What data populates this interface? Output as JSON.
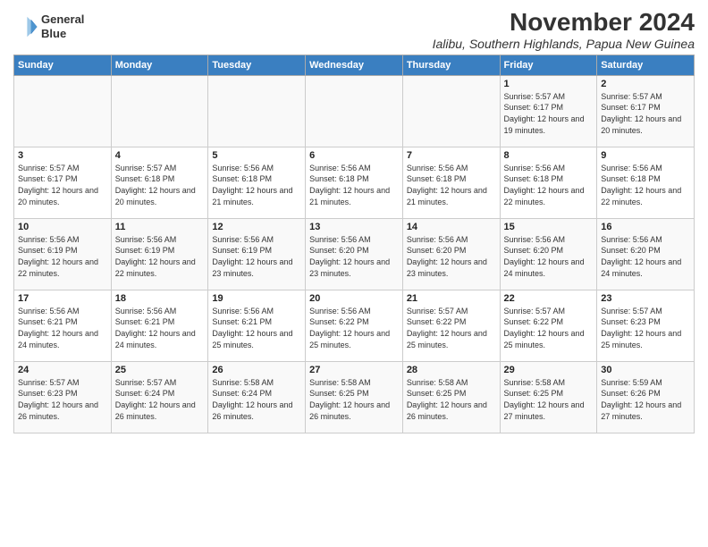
{
  "header": {
    "logo_line1": "General",
    "logo_line2": "Blue",
    "month": "November 2024",
    "location": "Ialibu, Southern Highlands, Papua New Guinea"
  },
  "weekdays": [
    "Sunday",
    "Monday",
    "Tuesday",
    "Wednesday",
    "Thursday",
    "Friday",
    "Saturday"
  ],
  "weeks": [
    [
      {
        "day": "",
        "info": ""
      },
      {
        "day": "",
        "info": ""
      },
      {
        "day": "",
        "info": ""
      },
      {
        "day": "",
        "info": ""
      },
      {
        "day": "",
        "info": ""
      },
      {
        "day": "1",
        "info": "Sunrise: 5:57 AM\nSunset: 6:17 PM\nDaylight: 12 hours and 19 minutes."
      },
      {
        "day": "2",
        "info": "Sunrise: 5:57 AM\nSunset: 6:17 PM\nDaylight: 12 hours and 20 minutes."
      }
    ],
    [
      {
        "day": "3",
        "info": "Sunrise: 5:57 AM\nSunset: 6:17 PM\nDaylight: 12 hours and 20 minutes."
      },
      {
        "day": "4",
        "info": "Sunrise: 5:57 AM\nSunset: 6:18 PM\nDaylight: 12 hours and 20 minutes."
      },
      {
        "day": "5",
        "info": "Sunrise: 5:56 AM\nSunset: 6:18 PM\nDaylight: 12 hours and 21 minutes."
      },
      {
        "day": "6",
        "info": "Sunrise: 5:56 AM\nSunset: 6:18 PM\nDaylight: 12 hours and 21 minutes."
      },
      {
        "day": "7",
        "info": "Sunrise: 5:56 AM\nSunset: 6:18 PM\nDaylight: 12 hours and 21 minutes."
      },
      {
        "day": "8",
        "info": "Sunrise: 5:56 AM\nSunset: 6:18 PM\nDaylight: 12 hours and 22 minutes."
      },
      {
        "day": "9",
        "info": "Sunrise: 5:56 AM\nSunset: 6:18 PM\nDaylight: 12 hours and 22 minutes."
      }
    ],
    [
      {
        "day": "10",
        "info": "Sunrise: 5:56 AM\nSunset: 6:19 PM\nDaylight: 12 hours and 22 minutes."
      },
      {
        "day": "11",
        "info": "Sunrise: 5:56 AM\nSunset: 6:19 PM\nDaylight: 12 hours and 22 minutes."
      },
      {
        "day": "12",
        "info": "Sunrise: 5:56 AM\nSunset: 6:19 PM\nDaylight: 12 hours and 23 minutes."
      },
      {
        "day": "13",
        "info": "Sunrise: 5:56 AM\nSunset: 6:20 PM\nDaylight: 12 hours and 23 minutes."
      },
      {
        "day": "14",
        "info": "Sunrise: 5:56 AM\nSunset: 6:20 PM\nDaylight: 12 hours and 23 minutes."
      },
      {
        "day": "15",
        "info": "Sunrise: 5:56 AM\nSunset: 6:20 PM\nDaylight: 12 hours and 24 minutes."
      },
      {
        "day": "16",
        "info": "Sunrise: 5:56 AM\nSunset: 6:20 PM\nDaylight: 12 hours and 24 minutes."
      }
    ],
    [
      {
        "day": "17",
        "info": "Sunrise: 5:56 AM\nSunset: 6:21 PM\nDaylight: 12 hours and 24 minutes."
      },
      {
        "day": "18",
        "info": "Sunrise: 5:56 AM\nSunset: 6:21 PM\nDaylight: 12 hours and 24 minutes."
      },
      {
        "day": "19",
        "info": "Sunrise: 5:56 AM\nSunset: 6:21 PM\nDaylight: 12 hours and 25 minutes."
      },
      {
        "day": "20",
        "info": "Sunrise: 5:56 AM\nSunset: 6:22 PM\nDaylight: 12 hours and 25 minutes."
      },
      {
        "day": "21",
        "info": "Sunrise: 5:57 AM\nSunset: 6:22 PM\nDaylight: 12 hours and 25 minutes."
      },
      {
        "day": "22",
        "info": "Sunrise: 5:57 AM\nSunset: 6:22 PM\nDaylight: 12 hours and 25 minutes."
      },
      {
        "day": "23",
        "info": "Sunrise: 5:57 AM\nSunset: 6:23 PM\nDaylight: 12 hours and 25 minutes."
      }
    ],
    [
      {
        "day": "24",
        "info": "Sunrise: 5:57 AM\nSunset: 6:23 PM\nDaylight: 12 hours and 26 minutes."
      },
      {
        "day": "25",
        "info": "Sunrise: 5:57 AM\nSunset: 6:24 PM\nDaylight: 12 hours and 26 minutes."
      },
      {
        "day": "26",
        "info": "Sunrise: 5:58 AM\nSunset: 6:24 PM\nDaylight: 12 hours and 26 minutes."
      },
      {
        "day": "27",
        "info": "Sunrise: 5:58 AM\nSunset: 6:25 PM\nDaylight: 12 hours and 26 minutes."
      },
      {
        "day": "28",
        "info": "Sunrise: 5:58 AM\nSunset: 6:25 PM\nDaylight: 12 hours and 26 minutes."
      },
      {
        "day": "29",
        "info": "Sunrise: 5:58 AM\nSunset: 6:25 PM\nDaylight: 12 hours and 27 minutes."
      },
      {
        "day": "30",
        "info": "Sunrise: 5:59 AM\nSunset: 6:26 PM\nDaylight: 12 hours and 27 minutes."
      }
    ]
  ]
}
